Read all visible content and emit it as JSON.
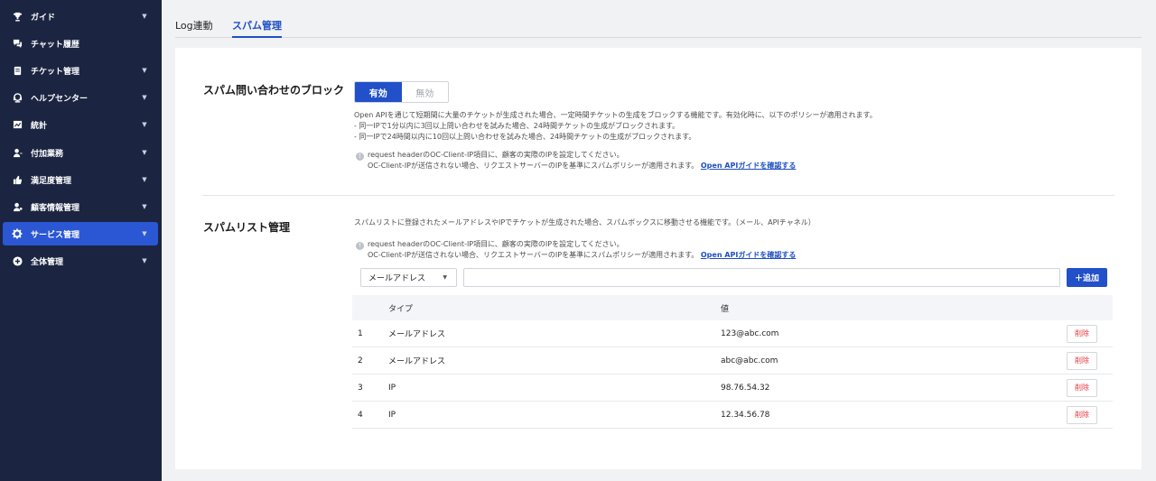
{
  "sidebar": {
    "items": [
      {
        "label": "ガイド",
        "icon": "trophy-icon",
        "has_chevron": true
      },
      {
        "label": "チャット履歴",
        "icon": "chat-icon",
        "has_chevron": false
      },
      {
        "label": "チケット管理",
        "icon": "ticket-icon",
        "has_chevron": true
      },
      {
        "label": "ヘルプセンター",
        "icon": "headset-icon",
        "has_chevron": true
      },
      {
        "label": "統計",
        "icon": "chart-icon",
        "has_chevron": true
      },
      {
        "label": "付加業務",
        "icon": "person-icon",
        "has_chevron": true
      },
      {
        "label": "満足度管理",
        "icon": "thumbs-up-icon",
        "has_chevron": true
      },
      {
        "label": "顧客情報管理",
        "icon": "customer-icon",
        "has_chevron": true
      },
      {
        "label": "サービス管理",
        "icon": "gear-icon",
        "has_chevron": true,
        "active": true
      },
      {
        "label": "全体管理",
        "icon": "plus-circle-icon",
        "has_chevron": true
      }
    ],
    "chevron": "▼"
  },
  "tabs": [
    {
      "label": "Log連動",
      "active": false
    },
    {
      "label": "スパム管理",
      "active": true
    }
  ],
  "spam_block": {
    "title": "スパム問い合わせのブロック",
    "toggle_on": "有効",
    "toggle_off": "無効",
    "desc_lines": [
      "Open APIを通じて短期間に大量のチケットが生成された場合、一定時間チケットの生成をブロックする機能です。有効化時に、以下のポリシーが適用されます。",
      "- 同一IPで1分以内に3回以上問い合わせを試みた場合、24時間チケットの生成がブロックされます。",
      "- 同一IPで24時間以内に10回以上問い合わせを試みた場合、24時間チケットの生成がブロックされます。"
    ],
    "note_icon": "!",
    "note_line1": "request headerのOC-Client-IP項目に、顧客の実際のIPを設定してください。",
    "note_line2": "OC-Client-IPが送信されない場合、リクエストサーバーのIPを基準にスパムポリシーが適用されます。",
    "note_link": "Open APIガイドを確認する"
  },
  "spam_list": {
    "title": "スパムリスト管理",
    "desc": "スパムリストに登録されたメールアドレスやIPでチケットが生成された場合、スパムボックスに移動させる機能です。（メール、APIチャネル）",
    "note_icon": "!",
    "note_line1": "request headerのOC-Client-IP項目に、顧客の実際のIPを設定してください。",
    "note_line2": "OC-Client-IPが送信されない場合、リクエストサーバーのIPを基準にスパムポリシーが適用されます。",
    "note_link": "Open APIガイドを確認する",
    "select_value": "メールアドレス",
    "select_caret": "▼",
    "input_value": "",
    "add_label": "＋追加",
    "columns": {
      "type": "タイプ",
      "value": "値"
    },
    "rows": [
      {
        "num": "1",
        "type": "メールアドレス",
        "value": "123@abc.com",
        "action": "削除"
      },
      {
        "num": "2",
        "type": "メールアドレス",
        "value": "abc@abc.com",
        "action": "削除"
      },
      {
        "num": "3",
        "type": "IP",
        "value": "98.76.54.32",
        "action": "削除"
      },
      {
        "num": "4",
        "type": "IP",
        "value": "12.34.56.78",
        "action": "削除"
      }
    ]
  },
  "colors": {
    "sidebar_bg": "#1b2542",
    "accent": "#2150c8",
    "active_item": "#2b57d4",
    "delete_text": "#e0393e"
  }
}
